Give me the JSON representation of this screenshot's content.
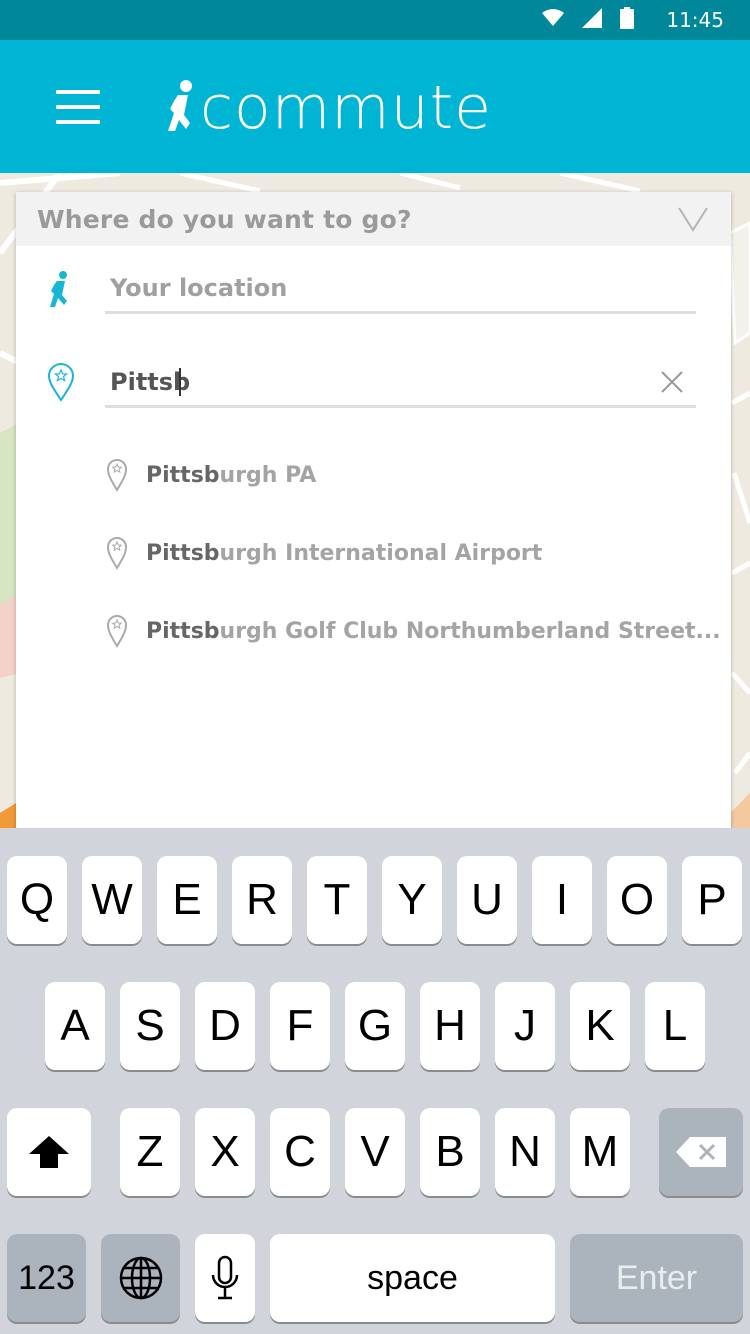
{
  "status_bar": {
    "time": "11:45"
  },
  "app_bar": {
    "logo_text": "commute"
  },
  "search_panel": {
    "title": "Where do you want to go?",
    "origin_placeholder": "Your location",
    "destination_value": "Pittsb",
    "suggestions": [
      {
        "match": "Pittsb",
        "rest": "urgh PA"
      },
      {
        "match": "Pittsb",
        "rest": "urgh International Airport"
      },
      {
        "match": "Pittsb",
        "rest": "urgh Golf Club Northumberland Street..."
      }
    ]
  },
  "keyboard": {
    "row1": [
      "Q",
      "W",
      "E",
      "R",
      "T",
      "Y",
      "U",
      "I",
      "O",
      "P"
    ],
    "row2": [
      "A",
      "S",
      "D",
      "F",
      "G",
      "H",
      "J",
      "K",
      "L"
    ],
    "row3": [
      "Z",
      "X",
      "C",
      "V",
      "B",
      "N",
      "M"
    ],
    "numbers_label": "123",
    "space_label": "space",
    "enter_label": "Enter"
  },
  "colors": {
    "status_bar": "#00879a",
    "app_bar": "#00b5d3",
    "accent": "#17b6d3"
  }
}
